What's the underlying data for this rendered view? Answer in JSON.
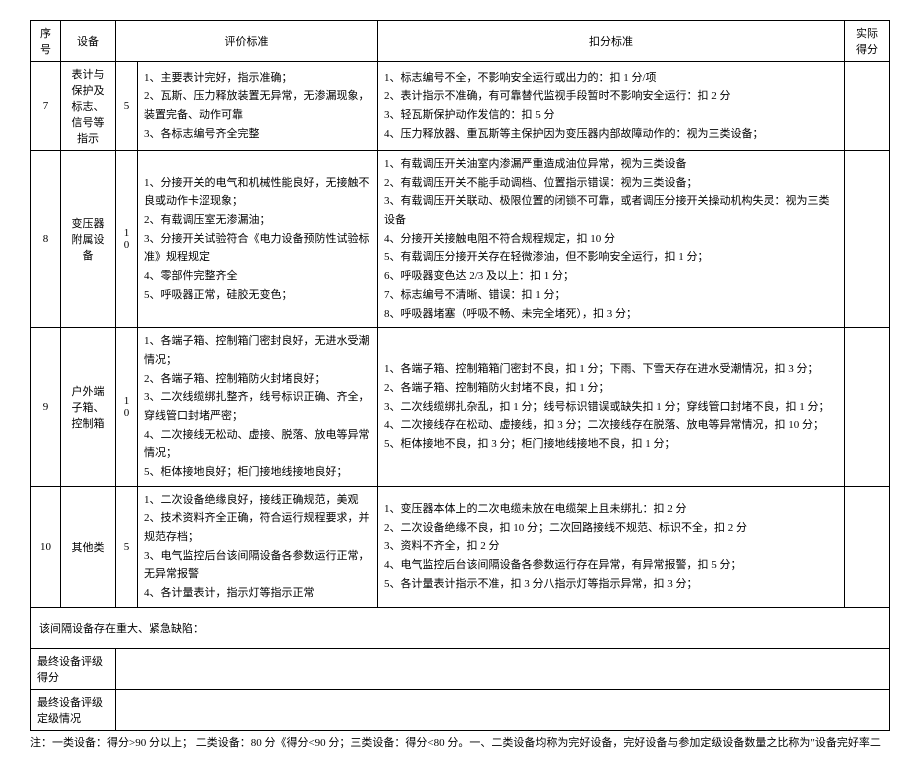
{
  "header": {
    "col1": "序号",
    "col2": "设备",
    "col3": "评价标准",
    "col4": "扣分标准",
    "col5": "实际得分"
  },
  "rows": [
    {
      "idx": "7",
      "device": "表计与保护及标志、信号等指示",
      "pts": "5",
      "criteria": "1、主要表计完好，指示准确；\n2、瓦斯、压力释放装置无异常，无渗漏现象，装置完备、动作可靠\n3、各标志编号齐全完整",
      "deduct": "1、标志编号不全，不影响安全运行或出力的：扣 1 分/项\n2、表计指示不准确，有可靠替代监视手段暂时不影响安全运行：扣 2 分\n3、轻瓦斯保护动作发信的：扣 5 分\n4、压力释放器、重瓦斯等主保护因为变压器内部故障动作的：视为三类设备；"
    },
    {
      "idx": "8",
      "device": "变压器附属设备",
      "pts": "10",
      "criteria": "1、分接开关的电气和机械性能良好，无接触不良或动作卡涩现象；\n2、有载调压室无渗漏油；\n3、分接开关试验符合《电力设备预防性试验标准》规程规定\n4、零部件完整齐全\n5、呼吸器正常，硅胶无变色；",
      "deduct": "1、有载调压开关油室内渗漏严重造成油位异常，视为三类设备\n2、有载调压开关不能手动调档、位置指示错误：视为三类设备；\n3、有载调压开关联动、极限位置的闭锁不可靠，或者调压分接开关操动机构失灵：视为三类设备\n4、分接开关接触电阻不符合规程规定，扣 10 分\n5、有载调压分接开关存在轻微渗油，但不影响安全运行，扣 1 分；\n6、呼吸器变色达 2/3 及以上：扣 1 分；\n7、标志编号不清晰、错误：扣 1 分；\n8、呼吸器堵塞（呼吸不畅、未完全堵死），扣 3 分；"
    },
    {
      "idx": "9",
      "device": "户外端子箱、控制箱",
      "pts": "10",
      "criteria": "1、各端子箱、控制箱门密封良好，无进水受潮情况；\n2、各端子箱、控制箱防火封堵良好；\n3、二次线缆绑扎整齐，线号标识正确、齐全，穿线管口封堵严密；\n4、二次接线无松动、虚接、脱落、放电等异常情况；\n5、柜体接地良好；柜门接地线接地良好；",
      "deduct": "1、各端子箱、控制箱箱门密封不良，扣 1 分；下雨、下雪天存在进水受潮情况，扣 3 分；\n2、各端子箱、控制箱防火封堵不良，扣 1 分；\n3、二次线缆绑扎杂乱，扣 1 分；线号标识错误或缺失扣 1 分；穿线管口封堵不良，扣 1 分；\n4、二次接线存在松动、虚接线，扣 3 分；二次接线存在脱落、放电等异常情况，扣 10 分；\n5、柜体接地不良，扣 3 分；柜门接地线接地不良，扣 1 分；"
    },
    {
      "idx": "10",
      "device": "其他类",
      "pts": "5",
      "criteria": "1、二次设备绝缘良好，接线正确规范，美观\n2、技术资料齐全正确，符合运行规程要求，并规范存档；\n3、电气监控后台该间隔设备各参数运行正常，无异常报警\n4、各计量表计，指示灯等指示正常",
      "deduct": "1、变压器本体上的二次电缆未放在电缆架上且未绑扎：扣 2 分\n2、二次设备绝缘不良，扣 10 分；二次回路接线不规范、标识不全，扣 2 分\n3、资料不齐全，扣 2 分\n4、电气监控后台该间隔设备各参数运行存在异常，有异常报警，扣 5 分；\n5、各计量表计指示不准，扣 3 分八指示灯等指示异常，扣 3 分；"
    }
  ],
  "footer": {
    "defect": "该间隔设备存在重大、紧急缺陷：",
    "scoreLabel": "最终设备评级得分",
    "gradeLabel": "最终设备评级定级情况"
  },
  "note": "注：一类设备：得分>90 分以上；    二类设备：80 分《得分<90 分；三类设备：得分<80 分。一、二类设备均称为完好设备，完好设备与参加定级设备数量之比称为\"设备完好率二"
}
